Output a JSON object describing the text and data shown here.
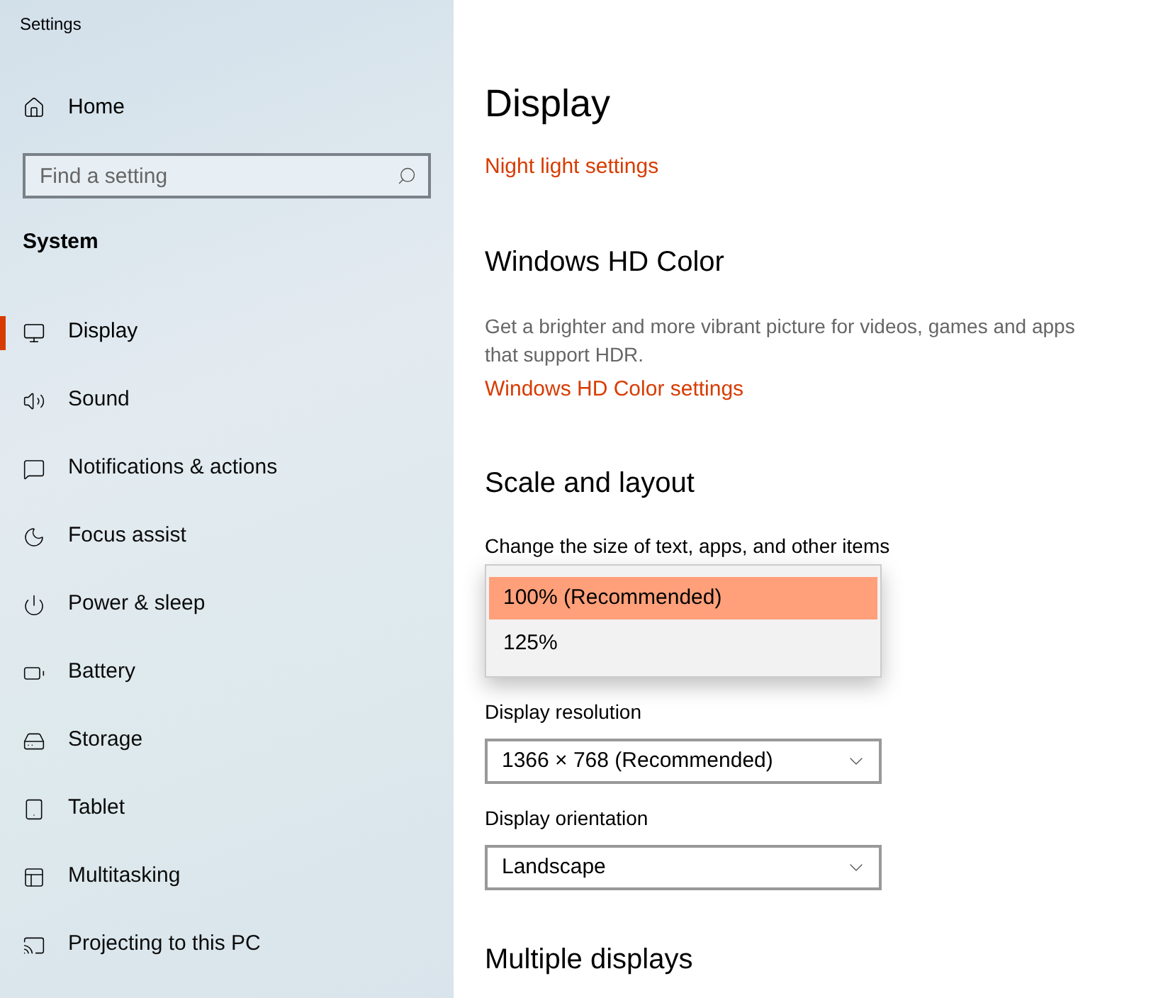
{
  "window": {
    "title": "Settings"
  },
  "sidebar": {
    "home": "Home",
    "search": {
      "placeholder": "Find a setting"
    },
    "section": "System",
    "items": [
      {
        "label": "Display",
        "selected": true
      },
      {
        "label": "Sound",
        "selected": false
      },
      {
        "label": "Notifications & actions",
        "selected": false
      },
      {
        "label": "Focus assist",
        "selected": false
      },
      {
        "label": "Power & sleep",
        "selected": false
      },
      {
        "label": "Battery",
        "selected": false
      },
      {
        "label": "Storage",
        "selected": false
      },
      {
        "label": "Tablet",
        "selected": false
      },
      {
        "label": "Multitasking",
        "selected": false
      },
      {
        "label": "Projecting to this PC",
        "selected": false
      }
    ]
  },
  "page": {
    "title": "Display",
    "night_light_link": "Night light settings",
    "hd_color": {
      "heading": "Windows HD Color",
      "description": "Get a brighter and more vibrant picture for videos, games and apps that support HDR.",
      "link": "Windows HD Color settings"
    },
    "scale": {
      "heading": "Scale and layout",
      "size_label": "Change the size of text, apps, and other items",
      "size_options": [
        {
          "label": "100% (Recommended)",
          "selected": true
        },
        {
          "label": "125%",
          "selected": false
        }
      ],
      "resolution_label": "Display resolution",
      "resolution_value": "1366 × 768 (Recommended)",
      "orientation_label": "Display orientation",
      "orientation_value": "Landscape"
    },
    "multiple_displays": {
      "heading": "Multiple displays"
    }
  }
}
